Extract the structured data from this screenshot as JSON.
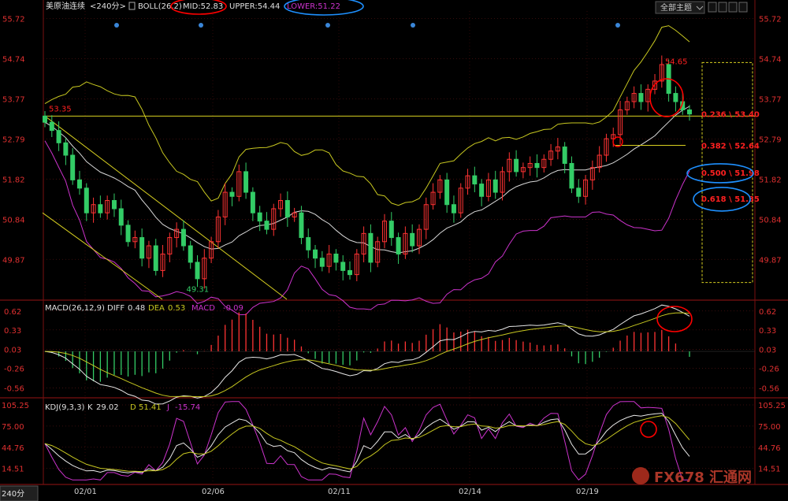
{
  "header": {
    "symbol": "美原油连续",
    "period": "<240分>",
    "boll_label": "BOLL(26,2)",
    "mid_label": "MID:52.83",
    "upper_label": "UPPER:54.44",
    "lower_label": "LOWER:51.22",
    "theme_button": "全部主题",
    "period_badge": "240分"
  },
  "colors": {
    "background": "#000000",
    "up_candle": "#ff3333",
    "down_candle": "#33cc66",
    "mid_line": "#d8d8d8",
    "upper_line": "#c8c820",
    "lower_line": "#cc33cc",
    "axis_text": "#e03030",
    "fib_text": "#ff2020",
    "annotation_red": "#ff0000",
    "annotation_blue": "#1e90ff",
    "trendline": "#d8d020",
    "dea_line": "#c8c820",
    "diff_line": "#e8e8e8",
    "kdj_j_line": "#cc33cc"
  },
  "chart_data": [
    {
      "type": "candlestick",
      "title": "美原油连续 <240分>",
      "y_ticks": [
        "55.72",
        "54.74",
        "53.77",
        "52.79",
        "51.82",
        "50.84",
        "49.87"
      ],
      "ylim": [
        48.9,
        55.9
      ],
      "x_ticks": [
        "02/01",
        "02/06",
        "02/11",
        "02/14",
        "02/19"
      ],
      "annotations": {
        "high_label": "54.65",
        "low_label": "49.31",
        "start_label": "53.35"
      },
      "fibonacci": [
        {
          "label": "0.236 \\ 53.40",
          "value": 53.4
        },
        {
          "label": "0.382 \\ 52.64",
          "value": 52.64
        },
        {
          "label": "0.500 \\ 51.98",
          "value": 51.98
        },
        {
          "label": "0.618 \\ 51.35",
          "value": 51.35
        }
      ],
      "fib_range": [
        49.31,
        54.65
      ],
      "closes": [
        53.2,
        53.0,
        52.7,
        52.4,
        51.8,
        51.6,
        51.0,
        51.2,
        51.0,
        51.3,
        51.1,
        50.7,
        50.3,
        50.4,
        49.9,
        50.2,
        49.6,
        50.0,
        50.4,
        50.6,
        50.2,
        49.8,
        49.4,
        49.9,
        50.3,
        50.9,
        51.5,
        51.4,
        52.0,
        51.5,
        51.0,
        50.8,
        50.6,
        51.1,
        51.3,
        50.9,
        51.0,
        50.4,
        50.1,
        49.9,
        49.7,
        50.0,
        49.8,
        49.6,
        49.5,
        50.0,
        50.5,
        49.8,
        50.3,
        50.8,
        50.4,
        50.0,
        50.5,
        50.2,
        50.6,
        51.2,
        51.5,
        51.8,
        51.2,
        51.0,
        51.6,
        51.9,
        51.7,
        51.4,
        51.8,
        51.5,
        52.0,
        52.3,
        52.0,
        52.1,
        52.2,
        52.1,
        52.3,
        52.5,
        52.6,
        52.2,
        51.6,
        51.4,
        51.8,
        52.1,
        52.4,
        52.8,
        52.9,
        53.5,
        53.7,
        53.9,
        53.7,
        54.0,
        54.2,
        54.6,
        53.9,
        53.7,
        53.5,
        53.4
      ]
    },
    {
      "type": "line",
      "title": "MACD(26,12,9)",
      "legend": [
        {
          "name": "DIFF",
          "value": "0.48"
        },
        {
          "name": "DEA",
          "value": "0.53"
        },
        {
          "name": "MACD",
          "value": "-0.09"
        }
      ],
      "y_ticks": [
        "0.62",
        "0.33",
        "0.03",
        "-0.26",
        "-0.56"
      ],
      "ylim": [
        -0.7,
        0.75
      ]
    },
    {
      "type": "line",
      "title": "KDJ(9,3,3)",
      "legend": [
        {
          "name": "K",
          "value": "29.02"
        },
        {
          "name": "D",
          "value": "51.41"
        },
        {
          "name": "J",
          "value": "-15.74"
        }
      ],
      "y_ticks": [
        "105.25",
        "75.00",
        "44.76",
        "14.51"
      ],
      "ylim": [
        -5,
        112
      ]
    }
  ],
  "watermark": {
    "text": "FX678 汇通网"
  }
}
